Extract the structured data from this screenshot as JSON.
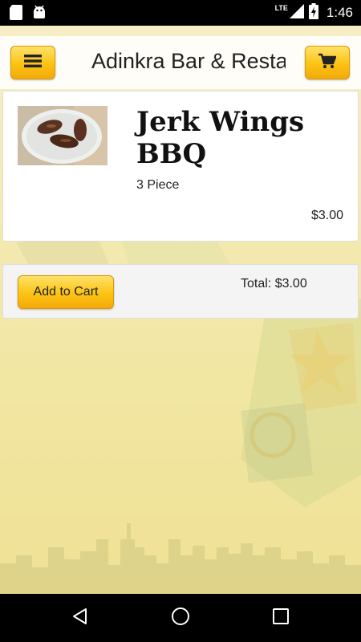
{
  "status_bar": {
    "time": "1:46",
    "network": "LTE",
    "icons": [
      "sd-card-icon",
      "android-icon",
      "signal-icon",
      "battery-charging-icon"
    ]
  },
  "app_bar": {
    "title": "Adinkra Bar & Restaurant",
    "menu_icon": "hamburger-menu-icon",
    "cart_icon": "shopping-cart-icon"
  },
  "item": {
    "name": "Jerk Wings BBQ",
    "description": "3 Piece",
    "price": "$3.00",
    "image": "jerk-wings-photo"
  },
  "cart": {
    "add_label": "Add to Cart",
    "total_label": "Total: $3.00"
  },
  "nav_bar": {
    "icons": [
      "back-icon",
      "home-icon",
      "recents-icon"
    ]
  },
  "colors": {
    "accent": "#fbc313",
    "background": "#f4ecb0",
    "status_bar": "#000000"
  }
}
